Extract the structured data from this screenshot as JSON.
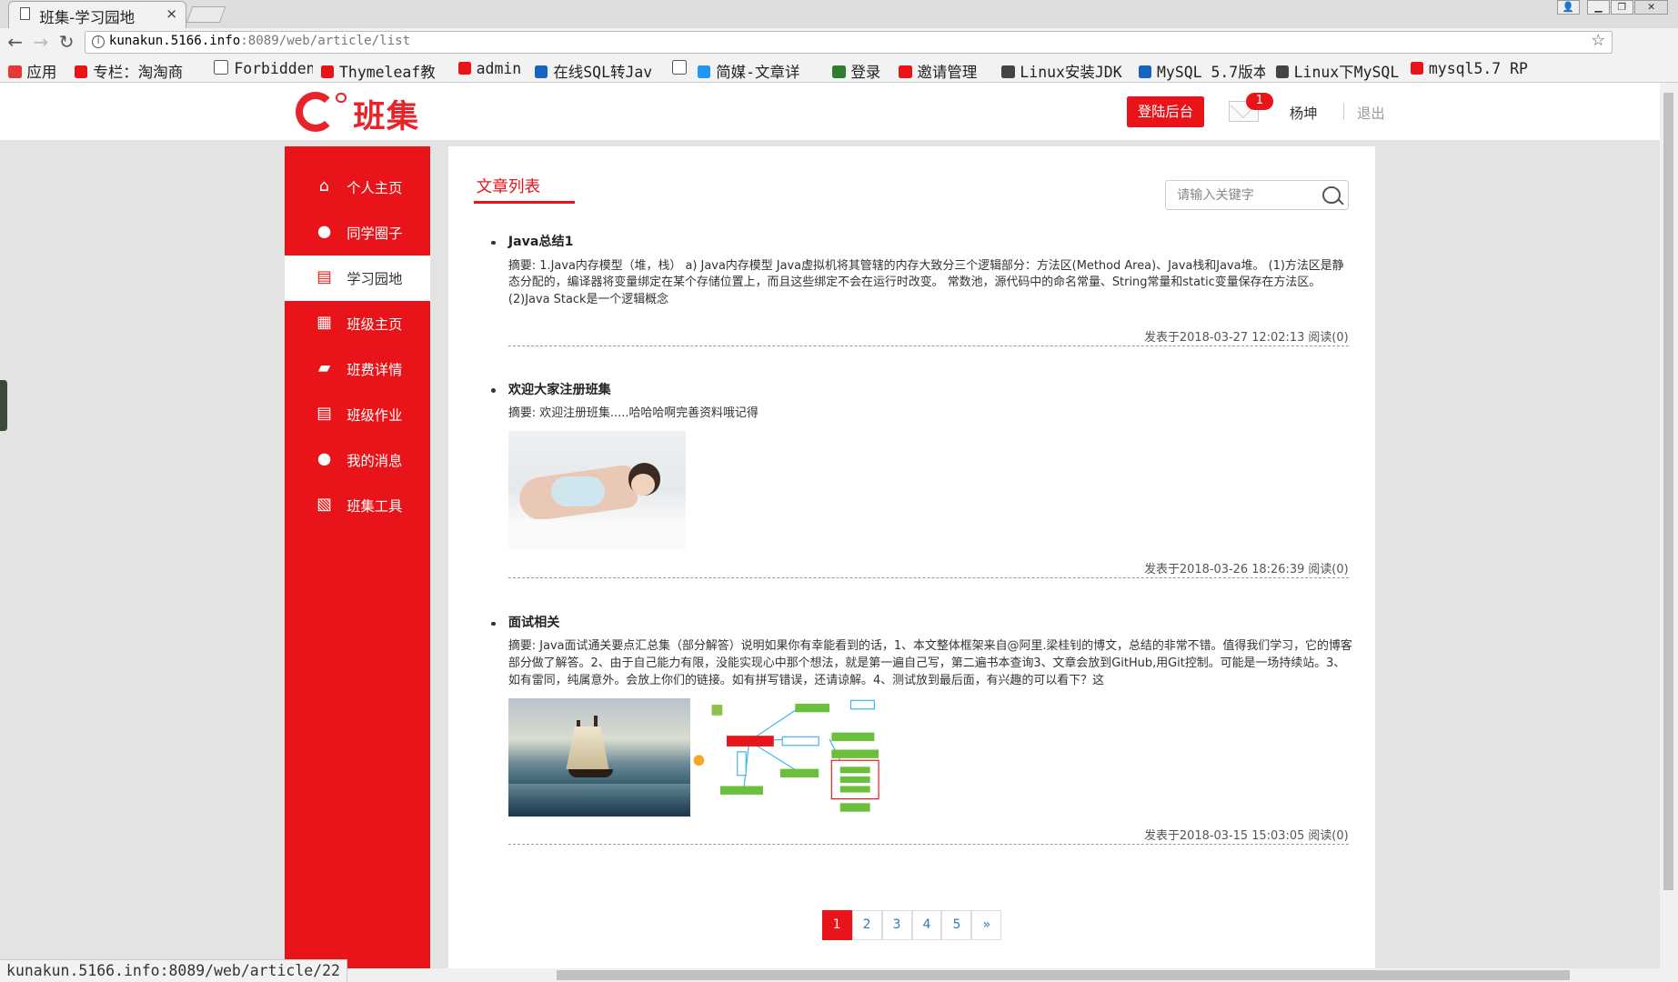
{
  "browser": {
    "tab_title": "班集-学习园地",
    "tab_close": "×",
    "url_host": "kunakun.5166.info",
    "url_rest": ":8089/web/article/list",
    "status_url": "kunakun.5166.info:8089/web/article/22",
    "bookmarks": [
      {
        "label": "应用",
        "icon": "apps-icon",
        "color": "#e53935"
      },
      {
        "label": "专栏：淘淘商",
        "icon": "csdn-icon",
        "color": "#e8141a"
      },
      {
        "label": "Forbidden",
        "icon": "page-icon",
        "color": "#ffffff"
      },
      {
        "label": "Thymeleaf教",
        "icon": "csdn-icon",
        "color": "#e8141a"
      },
      {
        "label": "admin",
        "icon": "jm-icon",
        "color": "#e8141a"
      },
      {
        "label": "在线SQL转Jav",
        "icon": "code-icon",
        "color": "#1565c0"
      },
      {
        "label": "",
        "icon": "page-icon",
        "color": "#ffffff"
      },
      {
        "label": "简媒-文章详",
        "icon": "jm-icon",
        "color": "#2196f3"
      },
      {
        "label": "登录",
        "icon": "green-icon",
        "color": "#2e7d32"
      },
      {
        "label": "邀请管理",
        "icon": "jm-icon",
        "color": "#e8141a"
      },
      {
        "label": "Linux安装JDK",
        "icon": "a-icon",
        "color": "#444444"
      },
      {
        "label": "MySQL 5.7版本",
        "icon": "mysql-icon",
        "color": "#1565c0"
      },
      {
        "label": "Linux下MySQL",
        "icon": "a-icon",
        "color": "#444444"
      },
      {
        "label": "mysql5.7 RPM",
        "icon": "csdn-icon",
        "color": "#e8141a"
      }
    ]
  },
  "header": {
    "logo_text": "班集",
    "login_button": "登陆后台",
    "mail_badge": "1",
    "username": "杨坤",
    "logout": "退出"
  },
  "sidebar": {
    "items": [
      {
        "label": "个人主页",
        "icon": "home-icon",
        "glyph": "⌂"
      },
      {
        "label": "同学圈子",
        "icon": "user-icon",
        "glyph": "●"
      },
      {
        "label": "学习园地",
        "icon": "document-icon",
        "glyph": "▤",
        "active": true
      },
      {
        "label": "班级主页",
        "icon": "gift-icon",
        "glyph": "▦"
      },
      {
        "label": "班费详情",
        "icon": "wallet-icon",
        "glyph": "▰"
      },
      {
        "label": "班级作业",
        "icon": "file-icon",
        "glyph": "▤"
      },
      {
        "label": "我的消息",
        "icon": "chat-icon",
        "glyph": "●"
      },
      {
        "label": "班集工具",
        "icon": "tool-icon",
        "glyph": "▧"
      }
    ]
  },
  "main": {
    "title": "文章列表",
    "search_placeholder": "请输入关键字",
    "articles": [
      {
        "title": "Java总结1",
        "summary": "摘要: 1.Java内存模型（堆，栈） a) Java内存模型 Java虚拟机将其管辖的内存大致分三个逻辑部分：方法区(Method Area)、Java栈和Java堆。 (1)方法区是静态分配的，编译器将变量绑定在某个存储位置上，而且这些绑定不会在运行时改变。 常数池，源代码中的命名常量、String常量和static变量保存在方法区。 (2)Java Stack是一个逻辑概念",
        "meta": "发表于2018-03-27 12:02:13 阅读(0)"
      },
      {
        "title": "欢迎大家注册班集",
        "summary": "摘要: 欢迎注册班集.....哈哈哈啊完善资料哦记得",
        "meta": "发表于2018-03-26 18:26:39 阅读(0)"
      },
      {
        "title": "面试相关",
        "summary": "摘要: Java面试通关要点汇总集（部分解答）说明如果你有幸能看到的话，1、本文整体框架来自@阿里.梁桂钊的博文，总结的非常不错。值得我们学习，它的博客部分做了解答。2、由于自己能力有限，没能实现心中那个想法，就是第一遍自己写，第二遍书本查询3、文章会放到GitHub,用Git控制。可能是一场持续站。3、如有雷同，纯属意外。会放上你们的链接。如有拼写错误，还请谅解。4、测试放到最后面，有兴趣的可以看下？这",
        "meta": "发表于2018-03-15 15:03:05 阅读(0)"
      }
    ],
    "pagination": [
      "1",
      "2",
      "3",
      "4",
      "5",
      "»"
    ],
    "current_page": "1"
  }
}
